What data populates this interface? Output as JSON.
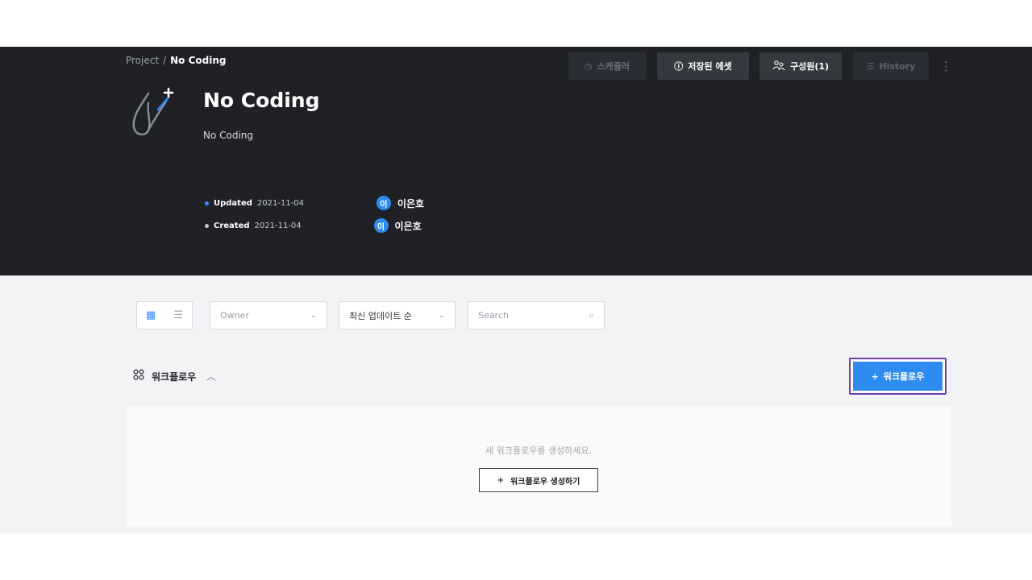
{
  "breadcrumb": {
    "root": "Project",
    "separator": "/",
    "current": "No Coding"
  },
  "toolbar": {
    "scheduler_label": "스케쥴러",
    "saved_assets_label": "저장된 에셋",
    "members_label": "구성원(1)",
    "history_label": "History"
  },
  "project": {
    "title": "No Coding",
    "description": "No Coding",
    "updated": {
      "label": "Updated",
      "date": "2021-11-04",
      "avatar_initial": "이",
      "user": "이은호"
    },
    "created": {
      "label": "Created",
      "date": "2021-11-04",
      "avatar_initial": "이",
      "user": "이은호"
    }
  },
  "filters": {
    "owner_placeholder": "Owner",
    "sort_selected": "최신 업데이트 순",
    "search_placeholder": "Search"
  },
  "section": {
    "title": "워크플로우",
    "add_button": "워크플로우"
  },
  "empty_state": {
    "message": "새 워크플로우를 생성하세요.",
    "create_button": "워크플로우 생성하기"
  },
  "colors": {
    "header_bg": "#1f2126",
    "accent": "#2e8cf0",
    "highlight_border": "#6e3ba8",
    "content_bg": "#f2f3f5"
  }
}
